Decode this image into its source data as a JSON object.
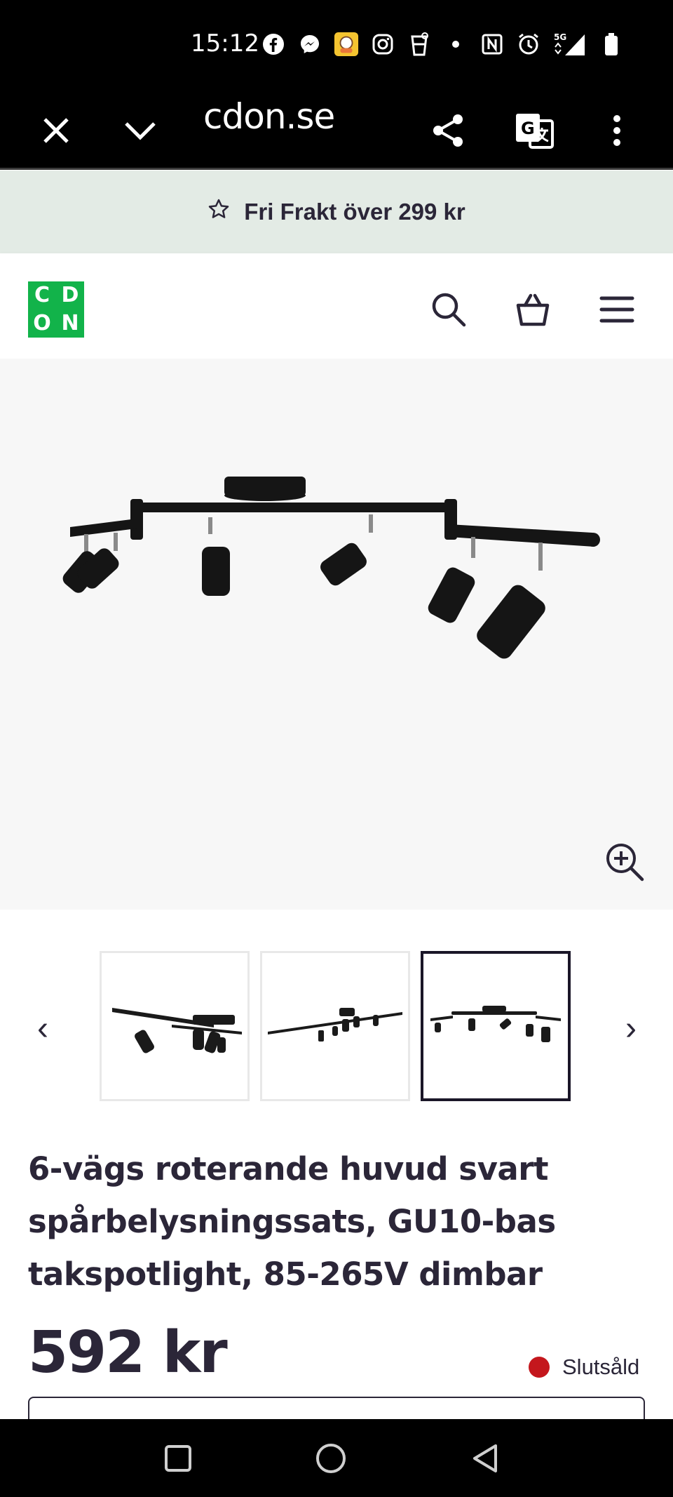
{
  "status_bar": {
    "time": "15:12",
    "icons": [
      "facebook-icon",
      "messenger-icon",
      "app-badge-icon",
      "instagram-icon",
      "glass-icon",
      "dot-icon",
      "nfc-icon",
      "alarm-icon",
      "5g-signal-icon",
      "battery-icon"
    ],
    "network": "5G"
  },
  "browser": {
    "url": "cdon.se",
    "icons": [
      "close-icon",
      "chevron-down-icon",
      "share-icon",
      "translate-icon",
      "more-vert-icon"
    ]
  },
  "promo": {
    "text": "Fri Frakt över 299 kr",
    "icon": "star-icon"
  },
  "header": {
    "logo_letters": [
      "C",
      "D",
      "O",
      "N"
    ],
    "icons": [
      "search-icon",
      "basket-icon",
      "menu-icon"
    ]
  },
  "gallery": {
    "prev_label": "‹",
    "next_label": "›",
    "active_thumbnail": 3,
    "thumbnail_count": 3
  },
  "product": {
    "title": "6-vägs roterande huvud svart spårbelysningssats, GU10-bas takspotlight, 85-265V dimbar",
    "price": "592 kr",
    "stock_status": "Slutsåld",
    "stock_color": "#c4171d"
  },
  "colors": {
    "brand_green": "#12b34a",
    "promo_bg": "#e3ebe5",
    "text_dark": "#2b2638"
  },
  "nav_bar": {
    "icons": [
      "recents-square-icon",
      "home-circle-icon",
      "back-triangle-icon"
    ]
  }
}
